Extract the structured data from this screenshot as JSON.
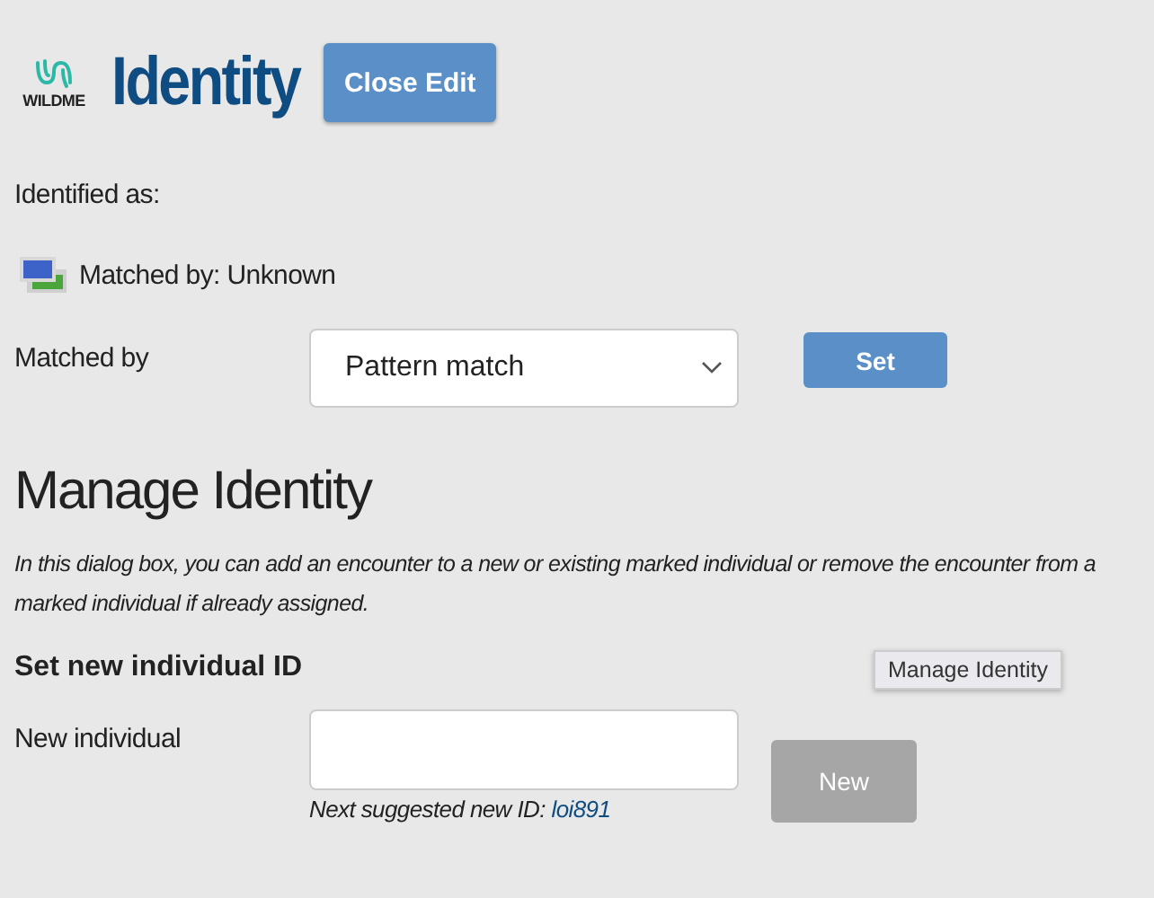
{
  "header": {
    "logo_text": "WILDME",
    "title": "Identity",
    "close_button": "Close Edit"
  },
  "identified_as": "Identified as:",
  "matched_status": "Matched by: Unknown",
  "matched_by": {
    "label": "Matched by",
    "value": "Pattern match",
    "button": "Set"
  },
  "manage": {
    "heading": "Manage Identity",
    "description": "In this dialog box, you can add an encounter to a new or existing marked individual or remove the encounter from a marked individual if already assigned.",
    "tooltip": "Manage Identity"
  },
  "new_individual": {
    "heading": "Set new individual ID",
    "label": "New individual",
    "button": "New",
    "button_disabled": true,
    "hint_prefix": "Next suggested new ID: ",
    "suggested_id": "loi891"
  }
}
